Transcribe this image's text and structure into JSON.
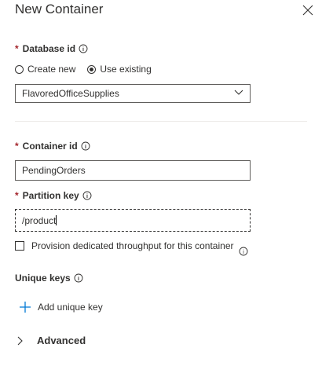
{
  "panel": {
    "title": "New Container",
    "close_icon": "close-icon"
  },
  "database": {
    "label": "Database id",
    "required_marker": "*",
    "mode_options": [
      "Create new",
      "Use existing"
    ],
    "mode_selected": "Use existing",
    "selected_database": "FlavoredOfficeSupplies"
  },
  "container": {
    "label": "Container id",
    "required_marker": "*",
    "value": "PendingOrders"
  },
  "partition": {
    "label": "Partition key",
    "required_marker": "*",
    "value": "/product"
  },
  "throughput": {
    "label": "Provision dedicated throughput for this container",
    "checked": false
  },
  "unique_keys": {
    "label": "Unique keys",
    "add_label": "Add unique key"
  },
  "advanced": {
    "label": "Advanced"
  },
  "colors": {
    "required": "#a4262c",
    "text": "#323130",
    "accent": "#0078d4",
    "border": "#605e5c"
  }
}
